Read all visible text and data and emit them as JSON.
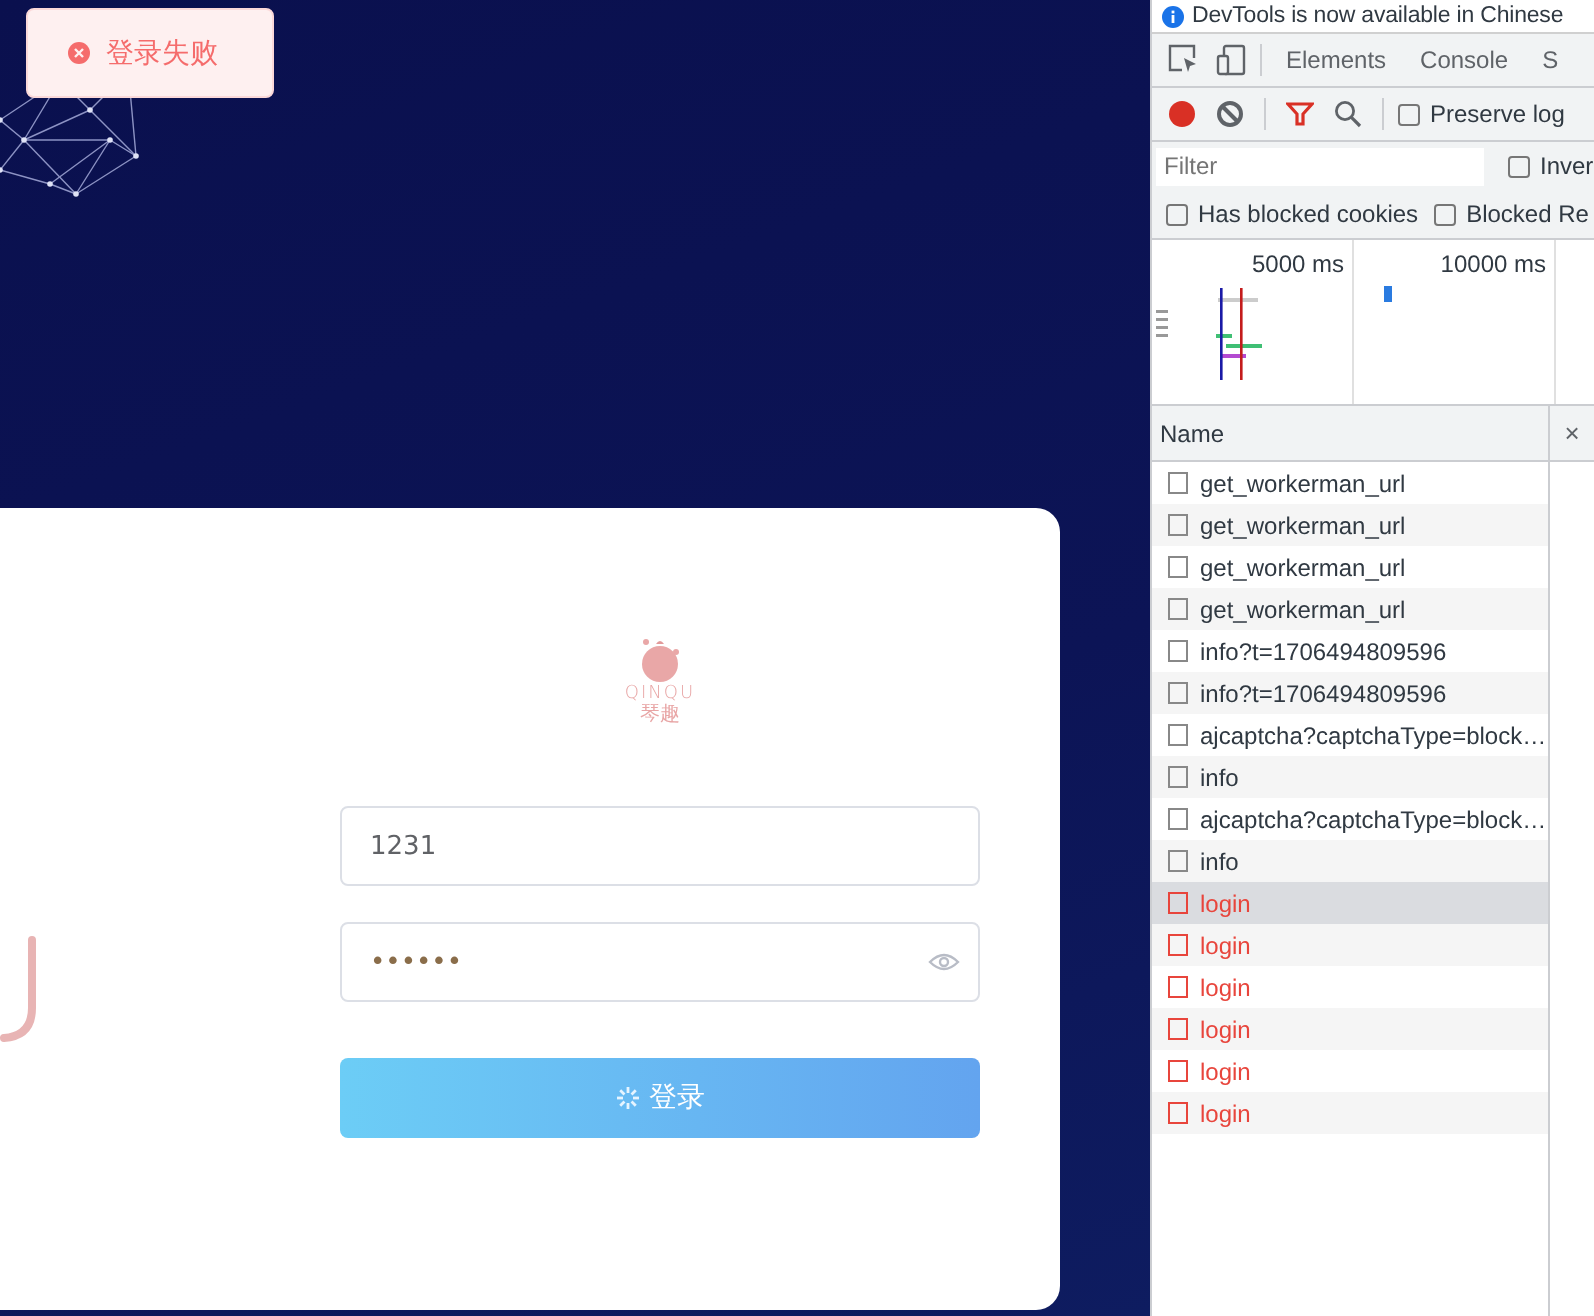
{
  "toast": {
    "kind": "error",
    "text": "登录失败"
  },
  "login_card": {
    "logo": {
      "wordmark": "QINQU",
      "subtitle": "琴趣"
    },
    "username": {
      "value": "1231"
    },
    "password": {
      "value": "••••••"
    },
    "login_button": {
      "label": "登录",
      "loading": true
    }
  },
  "devtools": {
    "banner": "DevTools is now available in Chinese",
    "tabs": [
      {
        "label": "Elements"
      },
      {
        "label": "Console"
      },
      {
        "label": "S"
      }
    ],
    "recording": true,
    "preserve_log": {
      "label": "Preserve log",
      "checked": false
    },
    "filter": {
      "placeholder": "Filter"
    },
    "invert": {
      "label": "Inver",
      "checked": false
    },
    "options": [
      {
        "label": "Has blocked cookies",
        "checked": false
      },
      {
        "label": "Blocked Re",
        "checked": false
      }
    ],
    "timeline_labels": [
      "5000 ms",
      "10000 ms"
    ],
    "close_symbol": "×",
    "table": {
      "columns": [
        "Name"
      ],
      "rows": [
        {
          "name": "get_workerman_url",
          "failed": false,
          "selected": false
        },
        {
          "name": "get_workerman_url",
          "failed": false,
          "selected": false
        },
        {
          "name": "get_workerman_url",
          "failed": false,
          "selected": false
        },
        {
          "name": "get_workerman_url",
          "failed": false,
          "selected": false
        },
        {
          "name": "info?t=1706494809596",
          "failed": false,
          "selected": false
        },
        {
          "name": "info?t=1706494809596",
          "failed": false,
          "selected": false
        },
        {
          "name": "ajcaptcha?captchaType=block…",
          "failed": false,
          "selected": false
        },
        {
          "name": "info",
          "failed": false,
          "selected": false
        },
        {
          "name": "ajcaptcha?captchaType=block…",
          "failed": false,
          "selected": false
        },
        {
          "name": "info",
          "failed": false,
          "selected": false
        },
        {
          "name": "login",
          "failed": true,
          "selected": true
        },
        {
          "name": "login",
          "failed": true,
          "selected": false
        },
        {
          "name": "login",
          "failed": true,
          "selected": false
        },
        {
          "name": "login",
          "failed": true,
          "selected": false
        },
        {
          "name": "login",
          "failed": true,
          "selected": false
        },
        {
          "name": "login",
          "failed": true,
          "selected": false
        }
      ]
    }
  }
}
